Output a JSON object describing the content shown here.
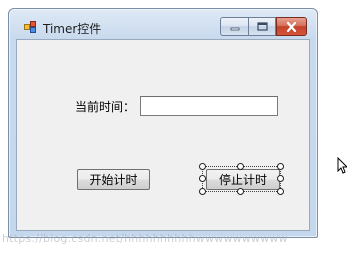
{
  "window": {
    "title": "Timer控件"
  },
  "form": {
    "time_label": "当前时间：",
    "time_value": "",
    "start_button": "开始计时",
    "stop_button": "停止计时"
  },
  "watermark": "https://blog.csdn.net/hhhhhhhhhhwwwwwwwwww"
}
